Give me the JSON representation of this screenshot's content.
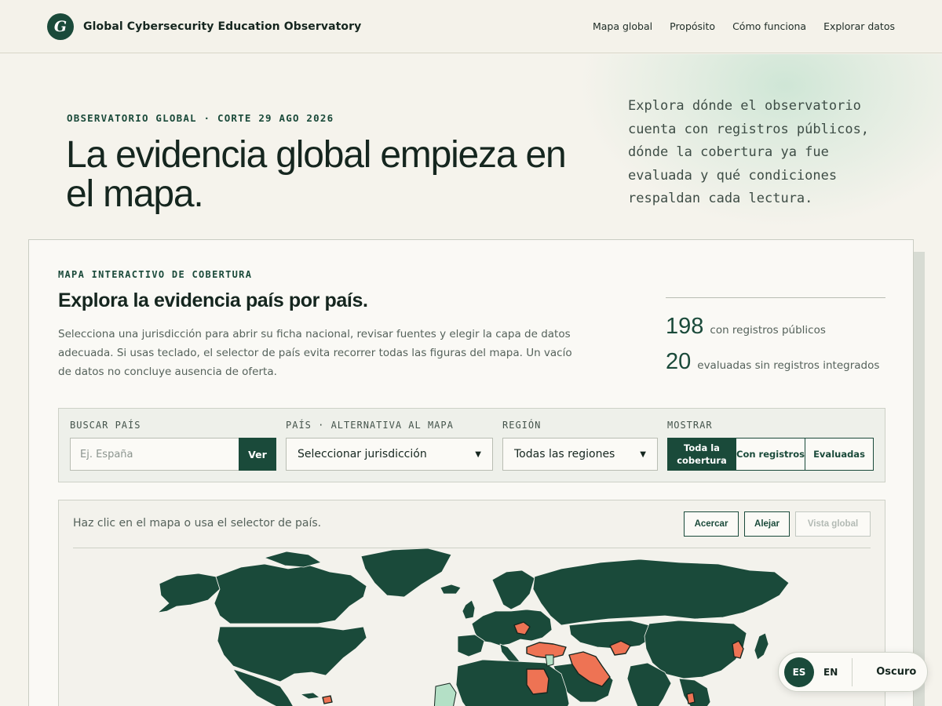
{
  "header": {
    "logo_letter": "G",
    "brand": "Global Cybersecurity Education Observatory",
    "nav": [
      "Mapa global",
      "Propósito",
      "Cómo funciona",
      "Explorar datos"
    ]
  },
  "hero": {
    "eyebrow": "OBSERVATORIO GLOBAL · CORTE 29 AGO 2026",
    "title": "La evidencia global empieza en el mapa.",
    "lead": "Explora dónde el observatorio cuenta con registros públicos, dónde la cobertura ya fue evaluada y qué condiciones respaldan cada lectura."
  },
  "card": {
    "eyebrow": "MAPA INTERACTIVO DE COBERTURA",
    "title": "Explora la evidencia país por país.",
    "description": "Selecciona una jurisdicción para abrir su ficha nacional, revisar fuentes y elegir la capa de datos adecuada. Si usas teclado, el selector de país evita recorrer todas las figuras del mapa. Un vacío de datos no concluye ausencia de oferta.",
    "stats": [
      {
        "value": "198",
        "label": "con registros públicos"
      },
      {
        "value": "20",
        "label": "evaluadas sin registros integrados"
      }
    ]
  },
  "filters": {
    "search_label": "BUSCAR PAÍS",
    "search_placeholder": "Ej. España",
    "search_button": "Ver",
    "country_label": "PAÍS · ALTERNATIVA AL MAPA",
    "country_value": "Seleccionar jurisdicción",
    "region_label": "REGIÓN",
    "region_value": "Todas las regiones",
    "show_label": "MOSTRAR",
    "show_options": [
      "Toda la cobertura",
      "Con registros",
      "Evaluadas"
    ],
    "show_selected": "Toda la cobertura"
  },
  "map": {
    "hint": "Haz clic en el mapa o usa el selector de país.",
    "zoom_in": "Acercar",
    "zoom_out": "Alejar",
    "reset": "Vista global",
    "colors": {
      "records": "#1a4a3a",
      "highlight": "#ee7354",
      "evaluated": "#b4e0c6",
      "background": "#f3f2ec"
    }
  },
  "widget": {
    "lang_es": "ES",
    "lang_en": "EN",
    "theme": "Oscuro"
  }
}
